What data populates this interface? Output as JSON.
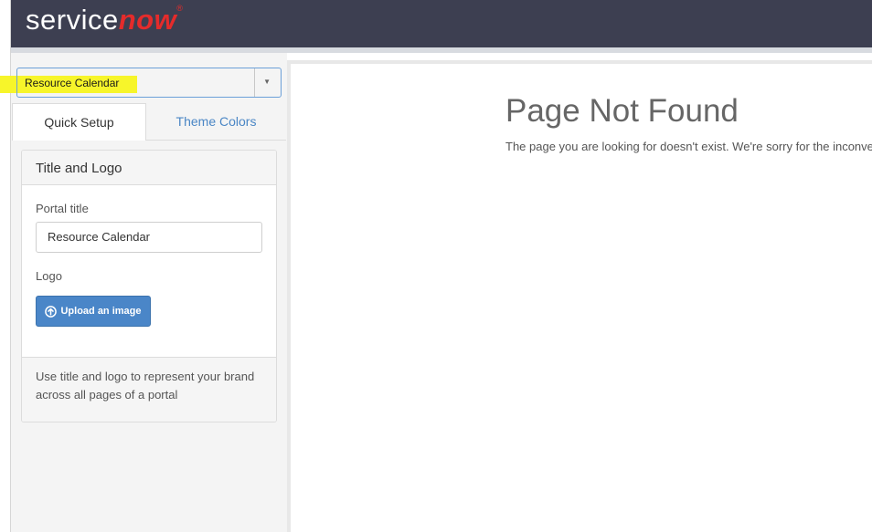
{
  "header": {
    "logo_service": "service",
    "logo_now": "now",
    "logo_tm": "®",
    "bg_color": "#3d3f51",
    "accent_color": "#e52b2b"
  },
  "portal_select": {
    "selected": "Resource Calendar",
    "caret_icon": "▼"
  },
  "tabs": [
    {
      "label": "Quick Setup",
      "active": true
    },
    {
      "label": "Theme Colors",
      "active": false
    }
  ],
  "panel": {
    "title": "Title and Logo",
    "portal_title_label": "Portal title",
    "portal_title_value": "Resource Calendar",
    "logo_label": "Logo",
    "upload_button": "Upload an image",
    "upload_icon": "arrow-up-circle-icon",
    "help_text": "Use title and logo to represent your brand across all pages of a portal"
  },
  "preview": {
    "title": "Page Not Found",
    "message": "The page you are looking for doesn't exist. We're sorry for the inconvenience."
  }
}
